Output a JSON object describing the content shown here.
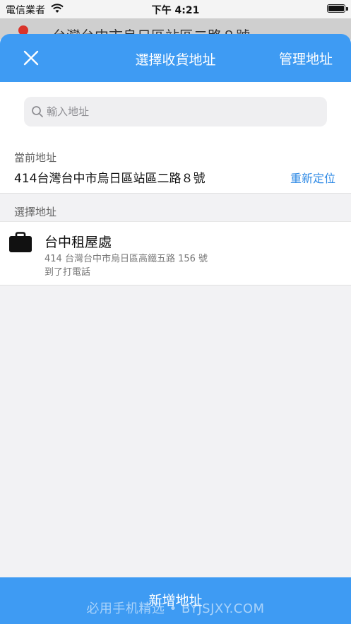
{
  "status_bar": {
    "carrier": "電信業者",
    "time": "下午 4:21"
  },
  "background_page": {
    "address": "台灣台中市烏日區站區二路８號"
  },
  "nav": {
    "title": "選擇收貨地址",
    "manage_label": "管理地址",
    "close_icon": "close-icon"
  },
  "search": {
    "placeholder": "輸入地址",
    "value": ""
  },
  "current": {
    "label": "當前地址",
    "address": "414台灣台中市烏日區站區二路８號",
    "relocate_label": "重新定位"
  },
  "select_section": {
    "header": "選擇地址"
  },
  "addresses": [
    {
      "icon": "briefcase-icon",
      "name": "台中租屋處",
      "address": "414 台灣台中市烏日區高鐵五路 156 號",
      "note": "到了打電話"
    }
  ],
  "footer": {
    "add_label": "新增地址",
    "watermark": "必用手机精选 • BYJSJXY.COM"
  },
  "colors": {
    "accent": "#3e9bf3",
    "link": "#2f8ae5"
  }
}
